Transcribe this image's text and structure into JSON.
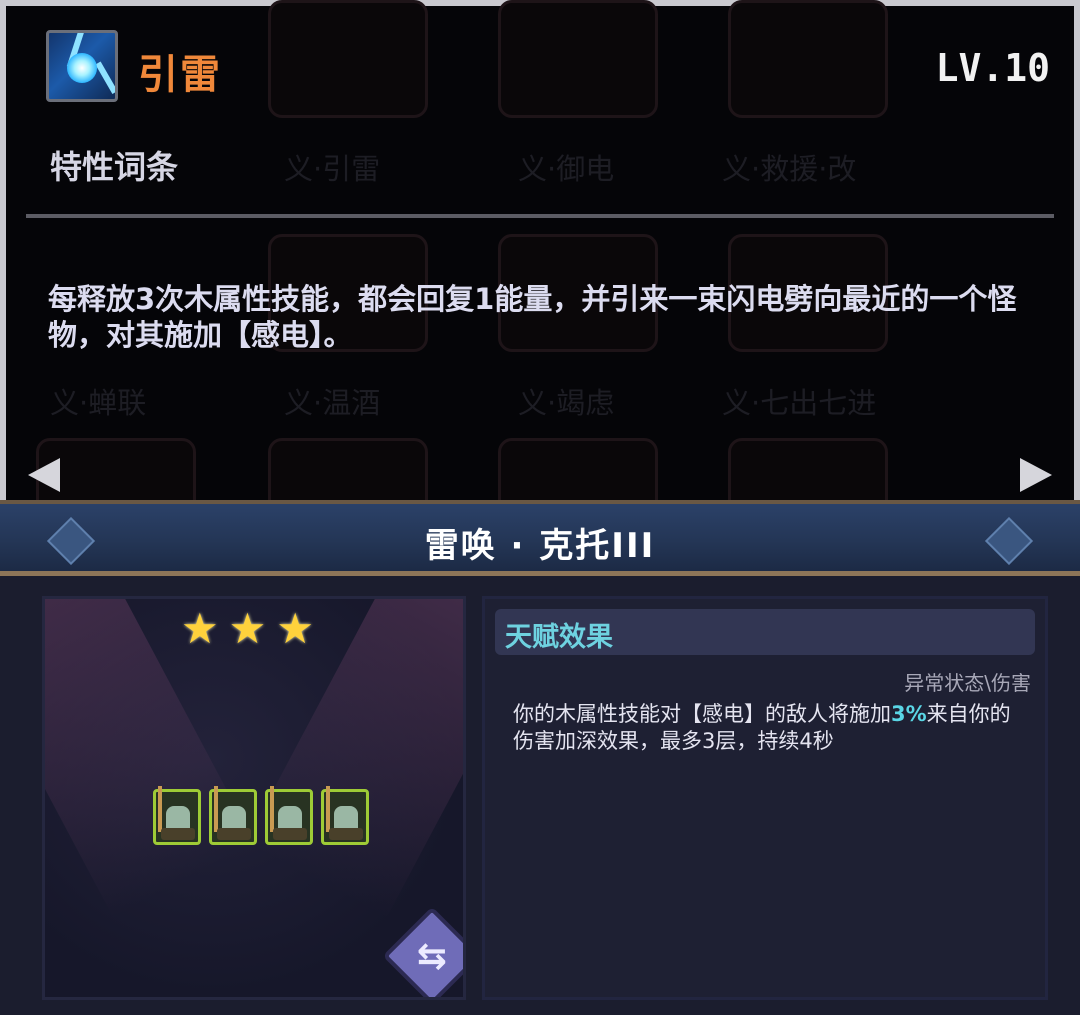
{
  "skill": {
    "name": "引雷",
    "level": "LV.10",
    "section_title": "特性词条",
    "description": "每释放3次木属性技能，都会回复1能量，并引来一束闪电劈向最近的一个怪物，对其施加【感电】。"
  },
  "background_slots": {
    "labels": [
      "义·引雷",
      "义·御电",
      "义·救援·改",
      "义·蝉联",
      "义·温酒",
      "义·竭虑",
      "义·七出七进"
    ]
  },
  "navigation": {
    "left_icon": "arrow-left-icon",
    "right_icon": "arrow-right-icon"
  },
  "hero_panel": {
    "title": "雷唤 · 克托III",
    "star_count": 3,
    "stars": [
      "★",
      "★",
      "★"
    ],
    "unit_count": 4,
    "swap_icon": "swap-icon",
    "swap_glyph": "⇆"
  },
  "talent": {
    "title": "天赋效果",
    "tags": "异常状态\\伤害",
    "desc_before": "你的木属性技能对【感电】的敌人将施加",
    "desc_highlight": "3%",
    "desc_after": "来自你的伤害加深效果，最多3层，持续4秒"
  },
  "colors": {
    "skill_name": "#f0883a",
    "talent_title": "#6ed2e0",
    "highlight": "#5ad6e6",
    "star": "#ffd23c",
    "unit_border": "#9ecb36"
  }
}
